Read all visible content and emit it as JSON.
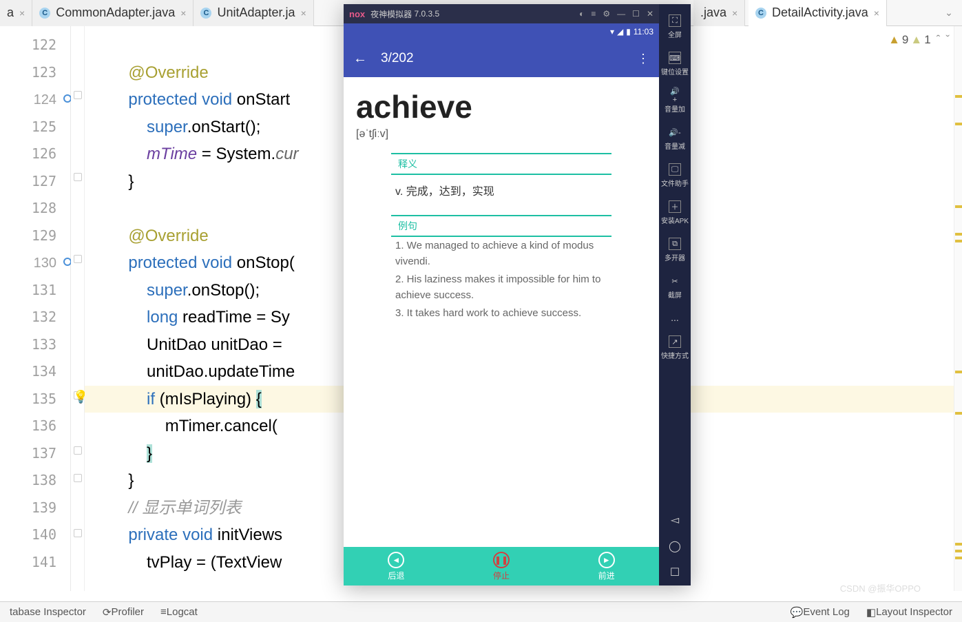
{
  "tabs": [
    {
      "label": "a",
      "icon": "C",
      "close": true
    },
    {
      "label": "CommonAdapter.java",
      "icon": "C",
      "close": true
    },
    {
      "label": "UnitAdapter.ja",
      "icon": "C",
      "close": true
    },
    {
      "label": ".java",
      "icon": "",
      "close": true,
      "partial": true
    },
    {
      "label": "DetailActivity.java",
      "icon": "C",
      "close": true,
      "active": true
    }
  ],
  "warnings": {
    "a": "9",
    "b": "1"
  },
  "lines": [
    "122",
    "123",
    "124",
    "125",
    "126",
    "127",
    "128",
    "129",
    "130",
    "131",
    "132",
    "133",
    "134",
    "135",
    "136",
    "137",
    "138",
    "139",
    "140",
    "141"
  ],
  "code": {
    "l123": "@Override",
    "l124a": "protected",
    "l124b": "void",
    "l124c": "onStart",
    "l125a": "super",
    "l125b": ".onStart();",
    "l126a": "mTime",
    "l126b": " = System.",
    "l126c": "cur",
    "l127": "}",
    "l129": "@Override",
    "l130a": "protected",
    "l130b": "void",
    "l130c": "onStop(",
    "l131a": "super",
    "l131b": ".onStop();",
    "l132a": "long",
    "l132b": " readTime = Sy",
    "l133": "UnitDao unitDao = ",
    "l134": "unitDao.updateTime",
    "l135a": "if",
    "l135b": " (mIsPlaying) ",
    "l135c": "{",
    "l136": "mTimer.cancel(",
    "l137": "}",
    "l138": "}",
    "l139": "// 显示单词列表",
    "l140a": "private",
    "l140b": "void",
    "l140c": "initViews",
    "l141": "tvPlay = (TextView"
  },
  "emulator": {
    "title": "夜神模拟器",
    "version": "7.0.3.5",
    "logo": "nox",
    "time": "11:03",
    "appbar": {
      "title": "3/202"
    },
    "word": "achieve",
    "pron": "[əˈtʃiːv]",
    "sec1": "释义",
    "def": "v. 完成，达到，实现",
    "sec2": "例句",
    "ex1": "1. We managed to achieve a kind of modus vivendi.",
    "ex2": "2. His laziness makes it impossible for him to achieve success.",
    "ex3": "3. It takes hard work to achieve success.",
    "btns": {
      "back": "后退",
      "stop": "停止",
      "fwd": "前进"
    },
    "side": [
      "全屏",
      "键位设置",
      "音量加",
      "音量减",
      "文件助手",
      "安装APK",
      "多开器",
      "截屏",
      "...",
      "快捷方式"
    ]
  },
  "status": {
    "a": "tabase Inspector",
    "b": "Profiler",
    "c": "Logcat",
    "d": "Event Log",
    "e": "Layout Inspector"
  },
  "watermark": "CSDN @振华OPPO"
}
